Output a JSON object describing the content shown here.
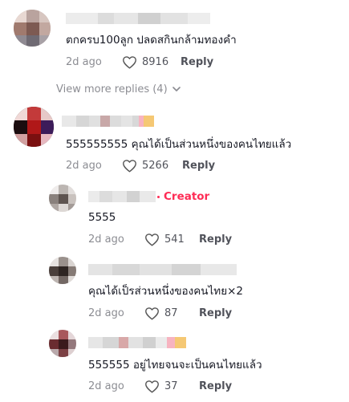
{
  "comments": [
    {
      "text": "ตกครบ100ลูก ปลดสกินกล้ามทองคำ",
      "time": "2d ago",
      "likes": "8916",
      "reply_label": "Reply"
    },
    {
      "text": "555555555 คุณได้เป็นส่วนหนึ่งของคนไทยแล้ว",
      "time": "2d ago",
      "likes": "5266",
      "reply_label": "Reply"
    }
  ],
  "view_more": {
    "label": "View more replies (4)"
  },
  "replies": [
    {
      "creator_label": "Creator",
      "text": "5555",
      "time": "2d ago",
      "likes": "541",
      "reply_label": "Reply"
    },
    {
      "text": "คุณได้เป็รส่วนหนึ่งของคนไทย×2",
      "time": "2d ago",
      "likes": "87",
      "reply_label": "Reply"
    },
    {
      "text": "555555 อยู่ไทยจนจะเป็นคนไทยแล้ว",
      "time": "2d ago",
      "likes": "37",
      "reply_label": "Reply"
    }
  ],
  "colors": {
    "text_primary": "#161823",
    "text_secondary": "#8a8b91",
    "creator_accent": "#fe2c55"
  },
  "icons": {
    "like": "heart-outline-icon",
    "expand": "chevron-down-icon"
  }
}
